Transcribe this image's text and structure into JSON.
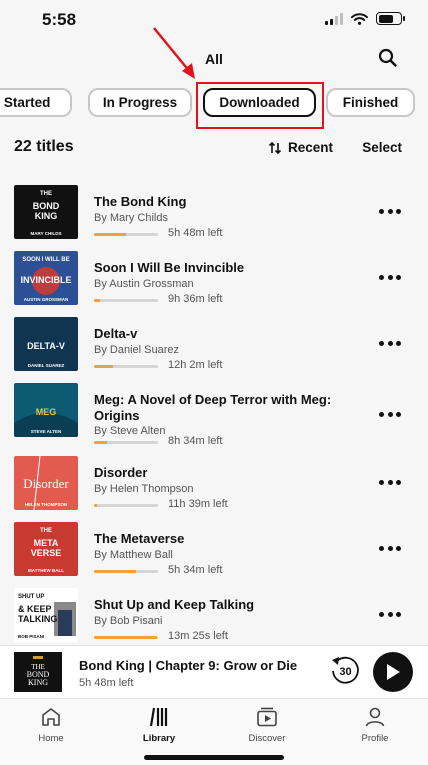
{
  "status": {
    "time": "5:58"
  },
  "header": {
    "title": "All"
  },
  "tabs": [
    {
      "label": "Not Started",
      "active": false
    },
    {
      "label": "In Progress",
      "active": false
    },
    {
      "label": "Downloaded",
      "active": true
    },
    {
      "label": "Finished",
      "active": false
    }
  ],
  "list_header": {
    "count": "22 titles",
    "sort_label": "Recent",
    "select_label": "Select"
  },
  "books": [
    {
      "title": "The Bond King",
      "author": "By Mary Childs",
      "time_left": "5h 48m left",
      "progress": 0.5,
      "cover": {
        "bg": "#111111",
        "top_text": "THE",
        "main_text": "BOND",
        "main_text2": "KING",
        "bottom_text": "MARY CHILDS",
        "accent": "#d79b2b"
      }
    },
    {
      "title": "Soon I Will Be Invincible",
      "author": "By Austin Grossman",
      "time_left": "9h 36m left",
      "progress": 0.1,
      "cover": {
        "bg": "#2c4f95",
        "top_text": "SOON I WILL BE",
        "main_text": "INVINCIBLE",
        "main_text2": "",
        "bottom_text": "AUSTIN GROSSMAN",
        "accent": "#d63a2f"
      }
    },
    {
      "title": "Delta-v",
      "author": "By Daniel Suarez",
      "time_left": "12h 2m left",
      "progress": 0.3,
      "cover": {
        "bg": "#0f3550",
        "top_text": "",
        "main_text": "DELTA-V",
        "main_text2": "",
        "bottom_text": "DANIEL SUAREZ",
        "accent": "#ffffff"
      }
    },
    {
      "title": "Meg: A Novel of Deep Terror with Meg: Origins",
      "author": "By Steve Alten",
      "time_left": "8h 34m left",
      "progress": 0.2,
      "cover": {
        "bg": "#0d5a73",
        "top_text": "",
        "main_text": "MEG",
        "main_text2": "",
        "bottom_text": "STEVE ALTEN",
        "accent": "#e9c545"
      }
    },
    {
      "title": "Disorder",
      "author": "By Helen Thompson",
      "time_left": "11h 39m left",
      "progress": 0.02,
      "cover": {
        "bg": "#e35a4f",
        "top_text": "",
        "main_text": "Disorder",
        "main_text2": "",
        "bottom_text": "HELEN THOMPSON",
        "accent": "#ffffff"
      }
    },
    {
      "title": "The Metaverse",
      "author": "By Matthew Ball",
      "time_left": "5h 34m left",
      "progress": 0.65,
      "cover": {
        "bg": "#c63a2f",
        "top_text": "THE",
        "main_text": "META",
        "main_text2": "VERSE",
        "bottom_text": "MATTHEW BALL",
        "accent": "#ffffff"
      }
    },
    {
      "title": "Shut Up and Keep Talking",
      "author": "By Bob Pisani",
      "time_left": "13m 25s left",
      "progress": 0.98,
      "cover": {
        "bg": "#ffffff",
        "top_text": "SHUT UP",
        "main_text": "& KEEP",
        "main_text2": "TALKING",
        "bottom_text": "BOB PISANI",
        "accent": "#111111"
      }
    }
  ],
  "mini_player": {
    "title": "Bond King | Chapter 9: Grow or Die",
    "subtitle": "5h 48m left",
    "rewind_seconds": "30"
  },
  "tabbar": [
    {
      "label": "Home",
      "icon": "home-icon",
      "active": false
    },
    {
      "label": "Library",
      "icon": "library-icon",
      "active": true
    },
    {
      "label": "Discover",
      "icon": "discover-icon",
      "active": false
    },
    {
      "label": "Profile",
      "icon": "profile-icon",
      "active": false
    }
  ],
  "colors": {
    "progress": "#f2a03d",
    "annotation": "#e3131b"
  }
}
